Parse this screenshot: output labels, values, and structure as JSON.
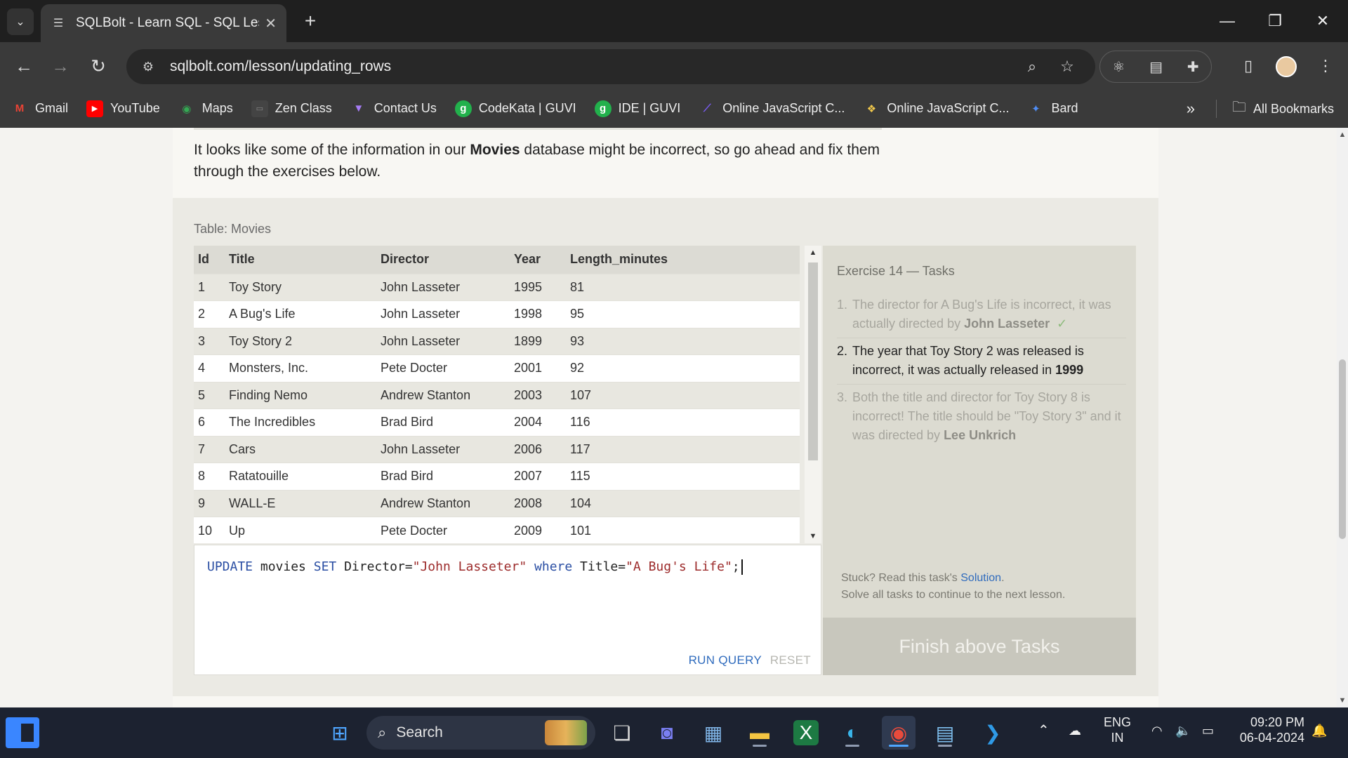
{
  "browser": {
    "tab_title": "SQLBolt - Learn SQL - SQL Less",
    "url": "sqlbolt.com/lesson/updating_rows",
    "bookmarks": [
      {
        "label": "Gmail",
        "icon": "gmail-icon",
        "color": "#ea4335"
      },
      {
        "label": "YouTube",
        "icon": "youtube-icon",
        "color": "#ff0000"
      },
      {
        "label": "Maps",
        "icon": "maps-icon",
        "color": "#34a853"
      },
      {
        "label": "Zen Class",
        "icon": "zen-class-icon",
        "color": "#444444"
      },
      {
        "label": "Contact Us",
        "icon": "contact-us-icon",
        "color": "#8a5cf6"
      },
      {
        "label": "CodeKata | GUVI",
        "icon": "guvi-icon",
        "color": "#22b14c"
      },
      {
        "label": "IDE | GUVI",
        "icon": "guvi-icon",
        "color": "#22b14c"
      },
      {
        "label": "Online JavaScript C...",
        "icon": "programiz-icon",
        "color": "#6b4cf5"
      },
      {
        "label": "Online JavaScript C...",
        "icon": "python-icon",
        "color": "#3776ab"
      },
      {
        "label": "Bard",
        "icon": "bard-icon",
        "color": "#4285f4"
      }
    ],
    "all_bookmarks": "All Bookmarks"
  },
  "lesson": {
    "intro_pre": "It looks like some of the information in our ",
    "intro_bold": "Movies",
    "intro_post": " database might be incorrect, so go ahead and fix them through the exercises below.",
    "table_label": "Table: Movies",
    "columns": [
      "Id",
      "Title",
      "Director",
      "Year",
      "Length_minutes"
    ],
    "rows": [
      [
        "1",
        "Toy Story",
        "John Lasseter",
        "1995",
        "81"
      ],
      [
        "2",
        "A Bug's Life",
        "John Lasseter",
        "1998",
        "95"
      ],
      [
        "3",
        "Toy Story 2",
        "John Lasseter",
        "1899",
        "93"
      ],
      [
        "4",
        "Monsters, Inc.",
        "Pete Docter",
        "2001",
        "92"
      ],
      [
        "5",
        "Finding Nemo",
        "Andrew Stanton",
        "2003",
        "107"
      ],
      [
        "6",
        "The Incredibles",
        "Brad Bird",
        "2004",
        "116"
      ],
      [
        "7",
        "Cars",
        "John Lasseter",
        "2006",
        "117"
      ],
      [
        "8",
        "Ratatouille",
        "Brad Bird",
        "2007",
        "115"
      ],
      [
        "9",
        "WALL-E",
        "Andrew Stanton",
        "2008",
        "104"
      ],
      [
        "10",
        "Up",
        "Pete Docter",
        "2009",
        "101"
      ]
    ],
    "query": {
      "update": "UPDATE",
      "table": " movies ",
      "set": "SET",
      "assign": " Director=",
      "value1": "\"John Lasseter\"",
      "where": "where",
      "cond": " Title=",
      "value2": "\"A Bug's Life\"",
      "end": ";"
    },
    "run_label": "RUN QUERY",
    "reset_label": "RESET",
    "tasks_title": "Exercise 14 — Tasks",
    "tasks": [
      {
        "num": "1.",
        "text": "The director for A Bug's Life is incorrect, it was actually directed by ",
        "bold": "John Lasseter",
        "status": "done",
        "mark": "✓"
      },
      {
        "num": "2.",
        "text": "The year that Toy Story 2 was released is incorrect, it was actually released in ",
        "bold": "1999",
        "status": "current"
      },
      {
        "num": "3.",
        "text": "Both the title and director for Toy Story 8 is incorrect! The title should be \"Toy Story 3\" and it was directed by ",
        "bold": "Lee Unkrich",
        "status": "pending"
      }
    ],
    "stuck_text": "Stuck? Read this task's ",
    "solution_link": "Solution",
    "stuck_end": ".",
    "solve_all": "Solve all tasks to continue to the next lesson.",
    "finish_label": "Finish above Tasks"
  },
  "taskbar": {
    "search_placeholder": "Search",
    "lang_1": "ENG",
    "lang_2": "IN",
    "time": "09:20 PM",
    "date": "06-04-2024"
  }
}
